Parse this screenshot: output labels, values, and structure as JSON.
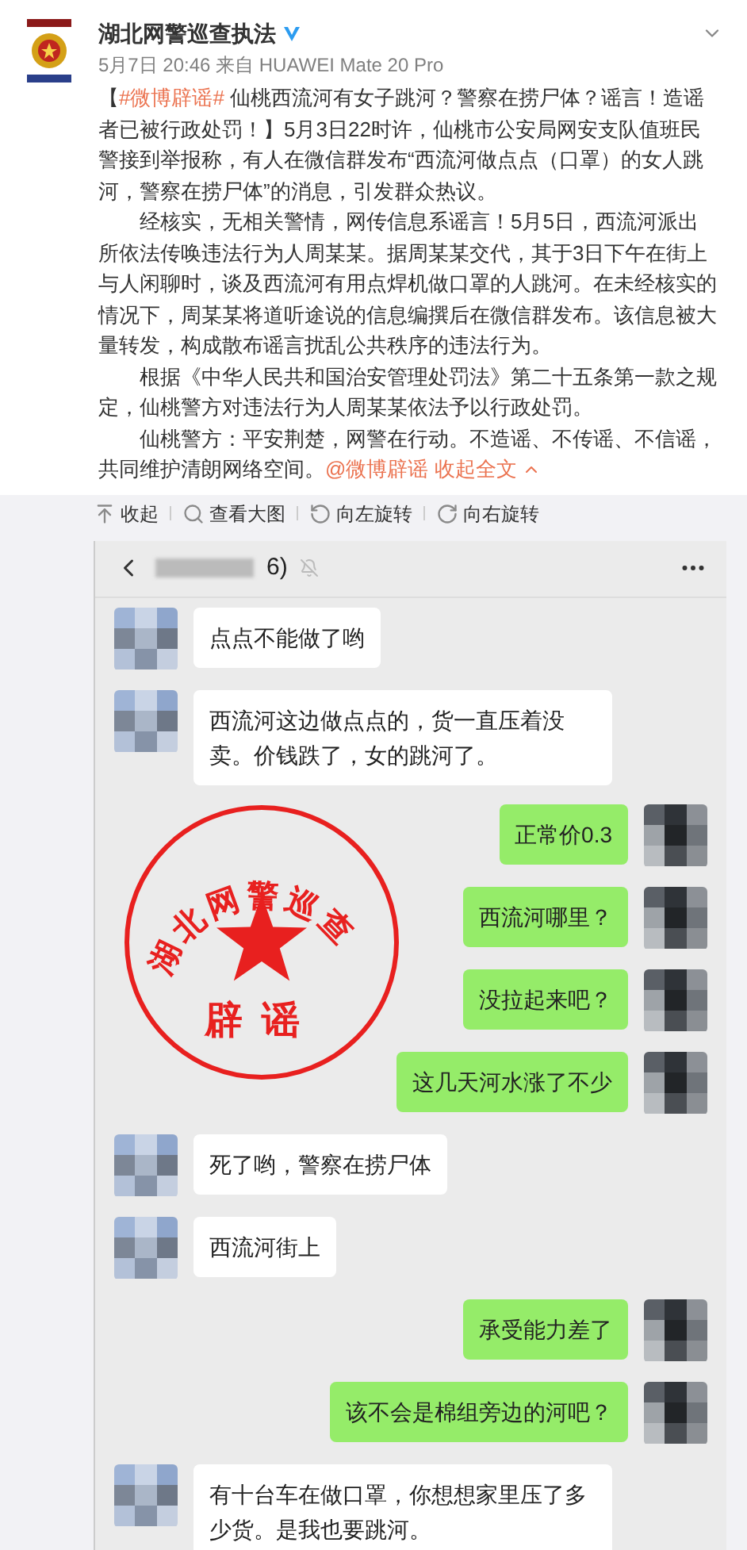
{
  "post": {
    "author": "湖北网警巡查执法",
    "verified": true,
    "meta": "5月7日 20:46 来自 HUAWEI Mate 20 Pro",
    "paragraphs": [
      {
        "kind": "lead",
        "prefix": "【",
        "hashtag": "#微博辟谣#",
        "text": " 仙桃西流河有女子跳河？警察在捞尸体？谣言！造谣者已被行政处罚！】5月3日22时许，仙桃市公安局网安支队值班民警接到举报称，有人在微信群发布“西流河做点点（口罩）的女人跳河，警察在捞尸体”的消息，引发群众热议。"
      },
      {
        "kind": "body",
        "text": "经核实，无相关警情，网传信息系谣言！5月5日，西流河派出所依法传唤违法行为人周某某。据周某某交代，其于3日下午在街上与人闲聊时，谈及西流河有用点焊机做口罩的人跳河。在未经核实的情况下，周某某将道听途说的信息编撰后在微信群发布。该信息被大量转发，构成散布谣言扰乱公共秩序的违法行为。"
      },
      {
        "kind": "body",
        "text": "根据《中华人民共和国治安管理处罚法》第二十五条第一款之规定，仙桃警方对违法行为人周某某依法予以行政处罚。"
      },
      {
        "kind": "closing",
        "text": "仙桃警方：平安荆楚，网警在行动。不造谣、不传谣、不信谣，共同维护清朗网络空间。",
        "mention": "@微博辟谣",
        "collapse": "收起全文"
      }
    ]
  },
  "toolbar": [
    {
      "kind": "collapse",
      "label": "收起"
    },
    {
      "kind": "zoom",
      "label": "查看大图"
    },
    {
      "kind": "rotate-left",
      "label": "向左旋转"
    },
    {
      "kind": "rotate-right",
      "label": "向右旋转"
    }
  ],
  "chat": {
    "title": "6)",
    "muted": true,
    "messages": [
      {
        "kind": "incoming",
        "text": "点点不能做了哟"
      },
      {
        "kind": "incoming",
        "text": "西流河这边做点点的，货一直压着没卖。价钱跌了，女的跳河了。"
      },
      {
        "kind": "outgoing",
        "text": "正常价0.3"
      },
      {
        "kind": "outgoing",
        "text": "西流河哪里？"
      },
      {
        "kind": "outgoing",
        "text": "没拉起来吧？"
      },
      {
        "kind": "outgoing",
        "text": "这几天河水涨了不少"
      },
      {
        "kind": "incoming",
        "text": "死了哟，警察在捞尸体"
      },
      {
        "kind": "incoming",
        "text": "西流河街上"
      },
      {
        "kind": "outgoing",
        "text": "承受能力差了"
      },
      {
        "kind": "outgoing",
        "text": "该不会是棉组旁边的河吧？"
      },
      {
        "kind": "incoming",
        "text": "有十台车在做口罩，你想想家里压了多少货。是我也要跳河。"
      }
    ]
  },
  "stamp": {
    "ring_text": "湖北网警巡查",
    "bottom_text": "辟谣"
  }
}
